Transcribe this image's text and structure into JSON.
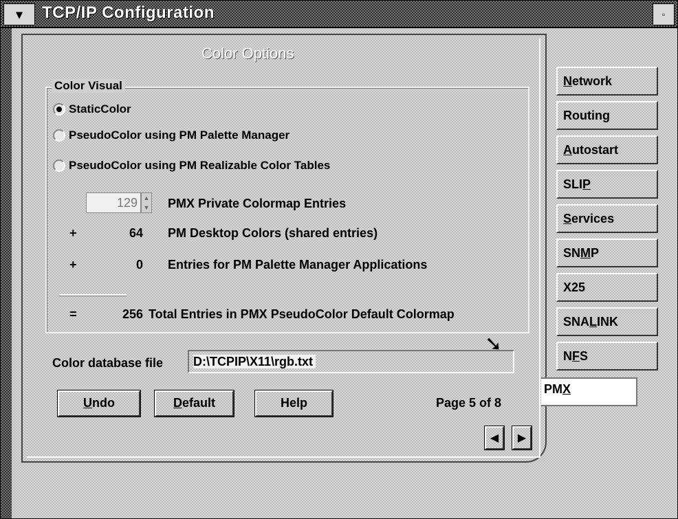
{
  "window": {
    "title": "TCP/IP Configuration",
    "sysmenu_glyph": "▾",
    "max_glyph": "▫"
  },
  "page": {
    "title": "Color Options",
    "group_label": "Color Visual",
    "radios": [
      {
        "label": "StaticColor",
        "selected": true
      },
      {
        "label": "PseudoColor using PM Palette Manager",
        "selected": false
      },
      {
        "label": "PseudoColor using PM Realizable Color Tables",
        "selected": false
      }
    ],
    "private_entries": {
      "value": "129",
      "label": "PMX Private Colormap Entries"
    },
    "desktop": {
      "sign": "+",
      "value": "64",
      "label": "PM Desktop Colors (shared entries)"
    },
    "palette_apps": {
      "sign": "+",
      "value": "0",
      "label": "Entries for PM Palette Manager Applications"
    },
    "total": {
      "sign": "=",
      "value": "256",
      "label": "Total Entries in PMX PseudoColor Default Colormap"
    },
    "db_label": "Color database file",
    "db_value": "D:\\TCPIP\\X11\\rgb.txt",
    "buttons": {
      "undo_mn": "U",
      "undo_rest": "ndo",
      "default_mn": "D",
      "default_rest": "efault",
      "help": "Help"
    },
    "page_info": "Page 5 of 8",
    "prev_glyph": "◀",
    "next_glyph": "▶"
  },
  "tabs": {
    "network_mn": "N",
    "network_rest": "etwork",
    "routing": "Routing",
    "autostart_mn": "A",
    "autostart_rest": "utostart",
    "slip_pre": "SLI",
    "slip_mn": "P",
    "services_mn": "S",
    "services_rest": "ervices",
    "snmp_pre": "SN",
    "snmp_mn": "M",
    "snmp_post": "P",
    "x25": "X25",
    "snalink_pre": "SNA",
    "snalink_mn": "L",
    "snalink_post": "INK",
    "nfs_pre": "N",
    "nfs_mn": "F",
    "nfs_post": "S",
    "pmx_pre": "PM",
    "pmx_mn": "X"
  },
  "colors": {
    "face": "#d0d0d0",
    "dark": "#333333",
    "highlight": "#ffffff"
  },
  "icons": {
    "cursor": "pointer-arrow-icon"
  }
}
